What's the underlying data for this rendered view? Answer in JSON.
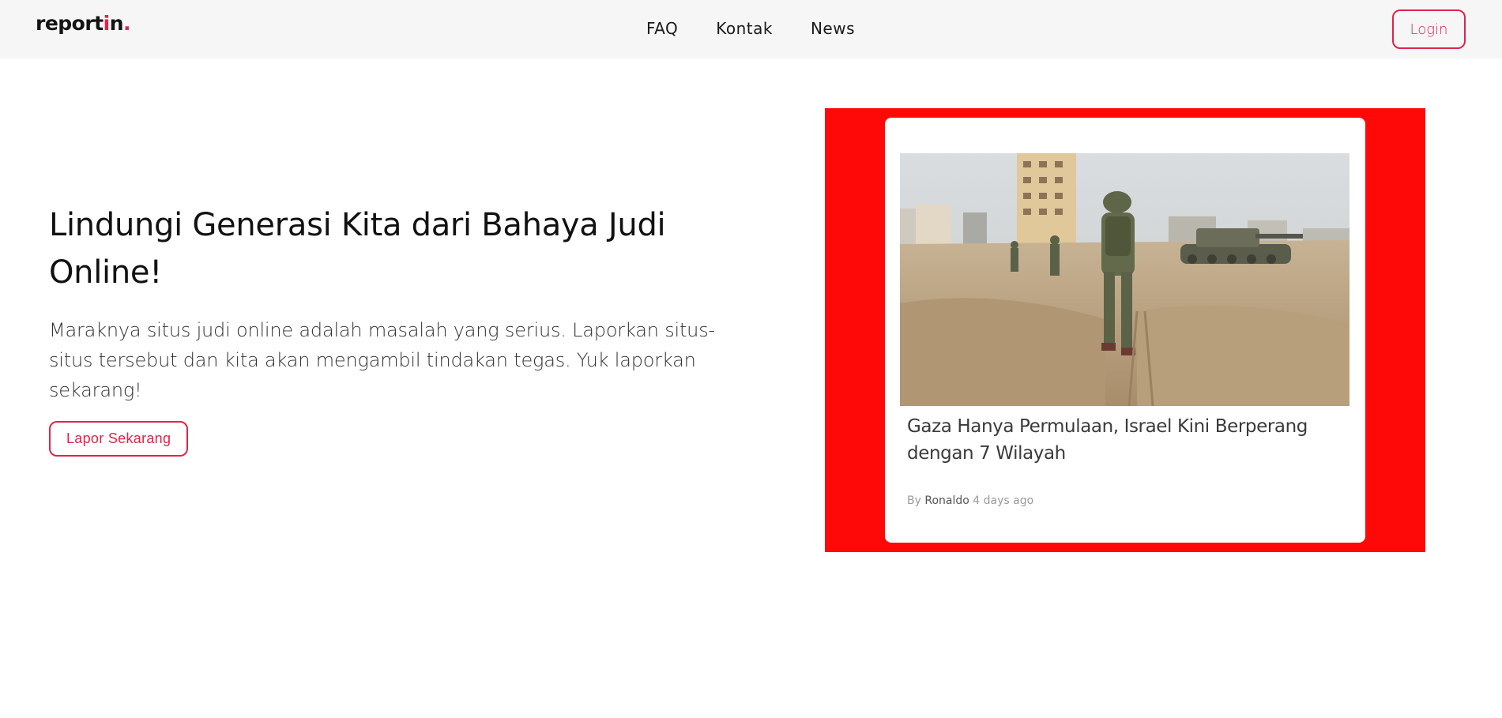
{
  "header": {
    "logo": {
      "text_before": "report",
      "text_i": "i",
      "text_after": "n",
      "dot": "."
    },
    "nav": [
      {
        "label": "FAQ"
      },
      {
        "label": "Kontak"
      },
      {
        "label": "News"
      }
    ],
    "login_label": "Login"
  },
  "hero": {
    "title": "Lindungi Generasi Kita dari Bahaya Judi Online!",
    "description": "Maraknya situs judi online adalah masalah yang serius. Laporkan situs-situs tersebut dan kita akan mengambil tindakan tegas. Yuk laporkan sekarang!",
    "cta_label": "Lapor Sekarang"
  },
  "news": {
    "title": "Gaza Hanya Permulaan, Israel Kini Berperang dengan 7 Wilayah",
    "by_label": "By",
    "author": "Ronaldo",
    "time_ago": "4 days ago",
    "image_icon": "news-photo-soldiers-icon"
  },
  "colors": {
    "accent": "#e0244a",
    "navbar_bg": "#f6f6f6",
    "panel_red": "#ff0808"
  }
}
